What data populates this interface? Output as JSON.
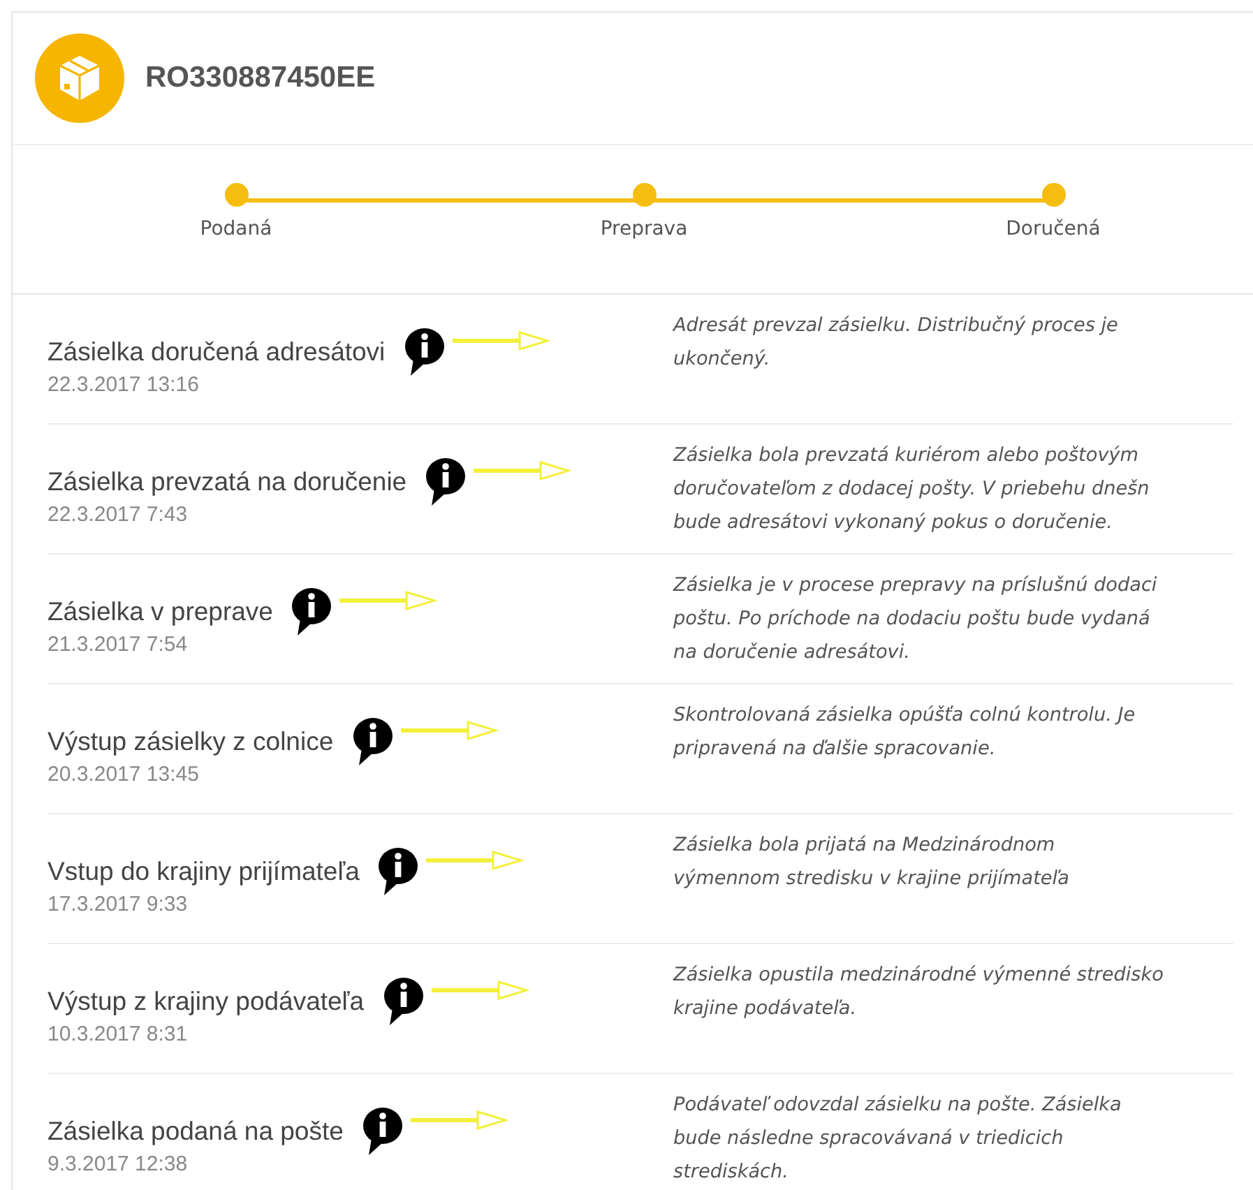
{
  "shipment": {
    "tracking_number": "RO330887450EE"
  },
  "steps": [
    {
      "label": "Podaná"
    },
    {
      "label": "Preprava"
    },
    {
      "label": "Doručená"
    }
  ],
  "events": [
    {
      "title": "Zásielka doručená adresátovi",
      "date": "22.3.2017 13:16",
      "description": [
        "Adresát prevzal zásielku. Distribučný proces je",
        "ukončený."
      ]
    },
    {
      "title": "Zásielka prevzatá na doručenie",
      "date": "22.3.2017 7:43",
      "description": [
        "Zásielka bola prevzatá kuriérom alebo poštovým",
        "doručovateľom z dodacej pošty. V priebehu dnešn",
        "bude adresátovi vykonaný pokus o doručenie."
      ]
    },
    {
      "title": "Zásielka v preprave",
      "date": "21.3.2017 7:54",
      "description": [
        "Zásielka je v procese prepravy na príslušnú dodaci",
        "poštu. Po príchode na dodaciu poštu bude vydaná",
        "na doručenie adresátovi."
      ]
    },
    {
      "title": "Výstup zásielky z colnice",
      "date": "20.3.2017 13:45",
      "description": [
        "Skontrolovaná zásielka opúšťa colnú kontrolu. Je",
        "pripravená na ďalšie spracovanie."
      ]
    },
    {
      "title": "Vstup do krajiny prijímateľa",
      "date": "17.3.2017 9:33",
      "description": [
        "Zásielka bola prijatá na Medzinárodnom",
        "výmennom stredisku v krajine prijímateľa"
      ]
    },
    {
      "title": "Výstup z krajiny podávateľa",
      "date": "10.3.2017 8:31",
      "description": [
        "Zásielka opustila medzinárodné výmenné stredisko",
        "krajine podávateľa."
      ]
    },
    {
      "title": "Zásielka podaná na pošte",
      "date": "9.3.2017 12:38",
      "description": [
        "Podávateľ odovzdal zásielku na pošte. Zásielka",
        "bude následne spracovávaná v triedicich",
        "strediskách."
      ]
    }
  ]
}
